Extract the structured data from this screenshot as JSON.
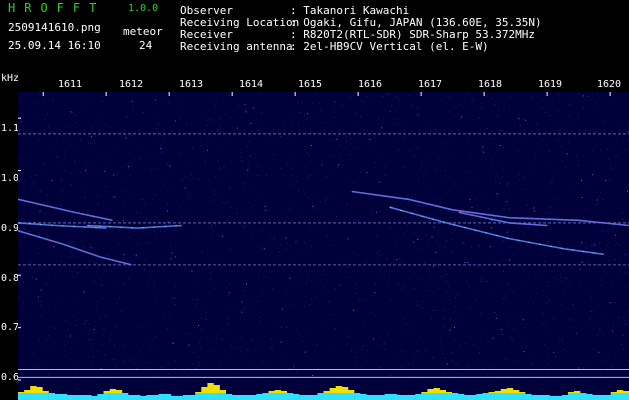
{
  "app": {
    "title": "HROFFT",
    "version": "1.0.0"
  },
  "file_name": "2509141610.png",
  "timestamp": "25.09.14 16:10",
  "meteor": {
    "label": "meteor",
    "count": "24"
  },
  "info": [
    {
      "label": "Observer",
      "value": ": Takanori Kawachi"
    },
    {
      "label": "Receiving Location",
      "value": ": Ogaki, Gifu, JAPAN (136.60E, 35.35N)"
    },
    {
      "label": "Receiver",
      "value": ": R820T2(RTL-SDR) SDR-Sharp 53.372MHz"
    },
    {
      "label": "Receiving antenna",
      "value": ": 2el-HB9CV Vertical (el. E-W)"
    }
  ],
  "colors": {
    "title_green": "#25d425",
    "plot_background": "#00003a",
    "noise": "#2a2aa0",
    "echo_line": "#5c7cf0",
    "echo_bright": "#ff40a0",
    "echo_mid": "#40ffa0",
    "hline": "#8899ee",
    "power_yellow": "#f0e000",
    "power_cyan": "#30e0ff"
  },
  "chart_data": {
    "type": "spectrogram",
    "yunit": "kHz",
    "y_ticks": [
      "1.1",
      "1.0",
      "0.9",
      "0.8",
      "0.7",
      "0.6"
    ],
    "x_ticks": [
      "1611",
      "1612",
      "1613",
      "1614",
      "1615",
      "1616",
      "1617",
      "1618",
      "1619",
      "1620"
    ],
    "ylim": [
      0.6,
      1.15
    ],
    "xlim": [
      1610.6,
      1620.3
    ],
    "carrier_khz": [
      1.07,
      0.9,
      0.82,
      0.62,
      0.605
    ],
    "echo_traces": [
      {
        "points": [
          [
            1610.6,
            0.945
          ],
          [
            1611.5,
            0.92
          ],
          [
            1612.1,
            0.905
          ]
        ]
      },
      {
        "points": [
          [
            1610.6,
            0.9
          ],
          [
            1611.2,
            0.895
          ],
          [
            1612.0,
            0.89
          ]
        ]
      },
      {
        "points": [
          [
            1610.6,
            0.885
          ],
          [
            1611.3,
            0.86
          ],
          [
            1611.9,
            0.835
          ],
          [
            1612.4,
            0.82
          ]
        ]
      },
      {
        "points": [
          [
            1611.7,
            0.895
          ],
          [
            1612.5,
            0.89
          ],
          [
            1613.2,
            0.895
          ]
        ]
      },
      {
        "points": [
          [
            1615.9,
            0.96
          ],
          [
            1616.8,
            0.945
          ],
          [
            1617.5,
            0.925
          ],
          [
            1618.4,
            0.91
          ],
          [
            1619.5,
            0.905
          ],
          [
            1620.3,
            0.895
          ]
        ]
      },
      {
        "points": [
          [
            1616.5,
            0.93
          ],
          [
            1617.4,
            0.9
          ],
          [
            1618.4,
            0.87
          ],
          [
            1619.3,
            0.85
          ],
          [
            1619.9,
            0.84
          ]
        ]
      },
      {
        "points": [
          [
            1617.6,
            0.92
          ],
          [
            1618.4,
            0.9
          ],
          [
            1619.0,
            0.895
          ]
        ]
      }
    ],
    "power_bins": [
      8,
      10,
      14,
      13,
      9,
      7,
      6,
      6,
      5,
      5,
      5,
      5,
      4,
      6,
      9,
      11,
      10,
      7,
      5,
      5,
      4,
      5,
      5,
      6,
      6,
      4,
      4,
      5,
      5,
      8,
      13,
      17,
      15,
      10,
      6,
      5,
      5,
      5,
      5,
      6,
      7,
      9,
      10,
      9,
      7,
      6,
      5,
      5,
      5,
      7,
      9,
      12,
      14,
      13,
      10,
      7,
      6,
      5,
      5,
      5,
      6,
      6,
      5,
      5,
      5,
      6,
      8,
      11,
      12,
      10,
      8,
      7,
      6,
      5,
      5,
      6,
      7,
      8,
      9,
      11,
      12,
      10,
      8,
      6,
      5,
      5,
      5,
      4,
      4,
      5,
      8,
      9,
      7,
      6,
      5,
      5,
      5,
      8,
      10,
      9
    ]
  }
}
